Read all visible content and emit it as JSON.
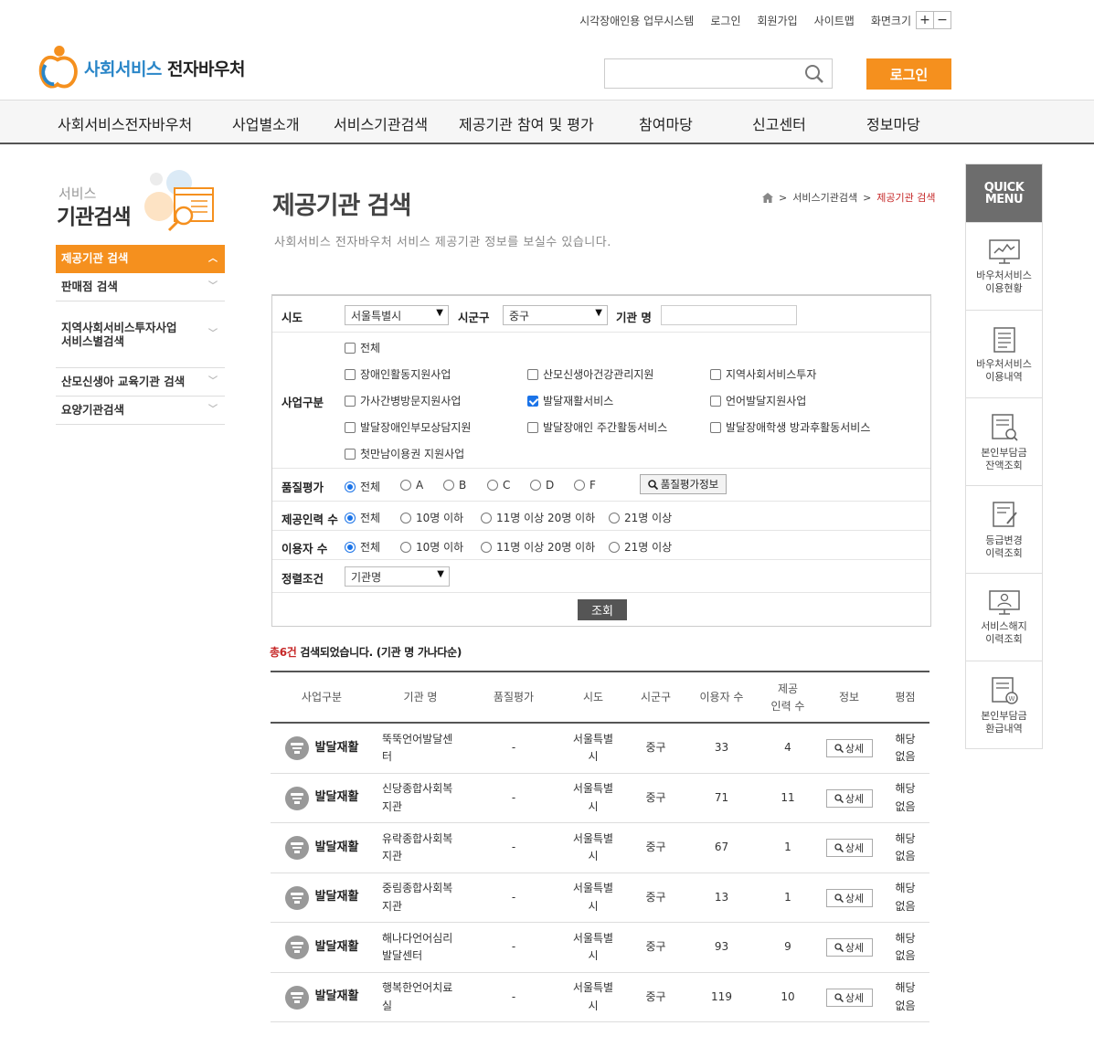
{
  "header": {
    "util_links": [
      "시각장애인용 업무시스템",
      "로그인",
      "회원가입",
      "사이트맵"
    ],
    "zoom_label": "화면크기",
    "zoom_in": "+",
    "zoom_out": "−",
    "logo_part1": "사회서비스",
    "logo_part2": "전자바우처",
    "search_placeholder": "",
    "login_button": "로그인"
  },
  "gnb": [
    "사회서비스전자바우처",
    "사업별소개",
    "서비스기관검색",
    "제공기관 참여 및 평가",
    "참여마당",
    "신고센터",
    "정보마당"
  ],
  "lnb": {
    "title_small": "서비스",
    "title_big": "기관검색",
    "items": [
      "제공기관 검색",
      "판매점 검색",
      "지역사회서비스투자사업\n서비스별검색",
      "산모신생아 교육기관 검색",
      "요양기관검색"
    ]
  },
  "page": {
    "title": "제공기관 검색",
    "desc": "사회서비스 전자바우처 서비스 제공기관 정보를 보실수 있습니다.",
    "breadcrumb": [
      "서비스기관검색",
      "제공기관 검색"
    ]
  },
  "form": {
    "sido_label": "시도",
    "sido_value": "서울특별시",
    "sigungu_label": "시군구",
    "sigungu_value": "중구",
    "org_label": "기관 명",
    "biz_label": "사업구분",
    "biz_all": "전체",
    "biz_options": [
      {
        "label": "장애인활동지원사업",
        "checked": false
      },
      {
        "label": "산모신생아건강관리지원",
        "checked": false
      },
      {
        "label": "지역사회서비스투자",
        "checked": false
      },
      {
        "label": "가사간병방문지원사업",
        "checked": false
      },
      {
        "label": "발달재활서비스",
        "checked": true
      },
      {
        "label": "언어발달지원사업",
        "checked": false
      },
      {
        "label": "발달장애인부모상담지원",
        "checked": false
      },
      {
        "label": "발달장애인 주간활동서비스",
        "checked": false
      },
      {
        "label": "발달장애학생 방과후활동서비스",
        "checked": false
      },
      {
        "label": "첫만남이용권 지원사업",
        "checked": false
      }
    ],
    "quality_label": "품질평가",
    "quality_options": [
      "전체",
      "A",
      "B",
      "C",
      "D",
      "F"
    ],
    "quality_button": "품질평가정보",
    "staff_label": "제공인력 수",
    "staff_options": [
      "전체",
      "10명 이하",
      "11명 이상 20명 이하",
      "21명 이상"
    ],
    "users_label": "이용자 수",
    "users_options": [
      "전체",
      "10명 이하",
      "11명 이상 20명 이하",
      "21명 이상"
    ],
    "sort_label": "정렬조건",
    "sort_value": "기관명",
    "submit": "조회"
  },
  "result": {
    "count": "총6건",
    "count_suffix": "검색되었습니다. (기관 명 가나다순)",
    "headers": [
      "사업구분",
      "기관 명",
      "품질평가",
      "시도",
      "시군구",
      "이용자 수",
      "제공\n인력 수",
      "정보",
      "평점"
    ],
    "detail_label": "상세",
    "rows": [
      {
        "biz": "발달재활",
        "name": "뚝뚝언어발달센\n터",
        "quality": "-",
        "sido": "서울특별\n시",
        "sigungu": "중구",
        "users": "33",
        "staff": "4",
        "score": "해당\n없음"
      },
      {
        "biz": "발달재활",
        "name": "신당종합사회복\n지관",
        "quality": "-",
        "sido": "서울특별\n시",
        "sigungu": "중구",
        "users": "71",
        "staff": "11",
        "score": "해당\n없음"
      },
      {
        "biz": "발달재활",
        "name": "유락종합사회복\n지관",
        "quality": "-",
        "sido": "서울특별\n시",
        "sigungu": "중구",
        "users": "67",
        "staff": "1",
        "score": "해당\n없음"
      },
      {
        "biz": "발달재활",
        "name": "중림종합사회복\n지관",
        "quality": "-",
        "sido": "서울특별\n시",
        "sigungu": "중구",
        "users": "13",
        "staff": "1",
        "score": "해당\n없음"
      },
      {
        "biz": "발달재활",
        "name": "해나다언어심리\n발달센터",
        "quality": "-",
        "sido": "서울특별\n시",
        "sigungu": "중구",
        "users": "93",
        "staff": "9",
        "score": "해당\n없음"
      },
      {
        "biz": "발달재활",
        "name": "행복한언어치료\n실",
        "quality": "-",
        "sido": "서울특별\n시",
        "sigungu": "중구",
        "users": "119",
        "staff": "10",
        "score": "해당\n없음"
      }
    ]
  },
  "quick": {
    "head": "QUICK\nMENU",
    "items": [
      "바우처서비스\n이용현황",
      "바우처서비스\n이용내역",
      "본인부담금\n잔액조회",
      "등급변경\n이력조회",
      "서비스해지\n이력조회",
      "본인부담금\n환급내역"
    ]
  },
  "colors": {
    "accent": "#f5901e",
    "primary_blue": "#2a86c8",
    "highlight_red": "#c62828",
    "checkbox_blue": "#1a73e8"
  }
}
